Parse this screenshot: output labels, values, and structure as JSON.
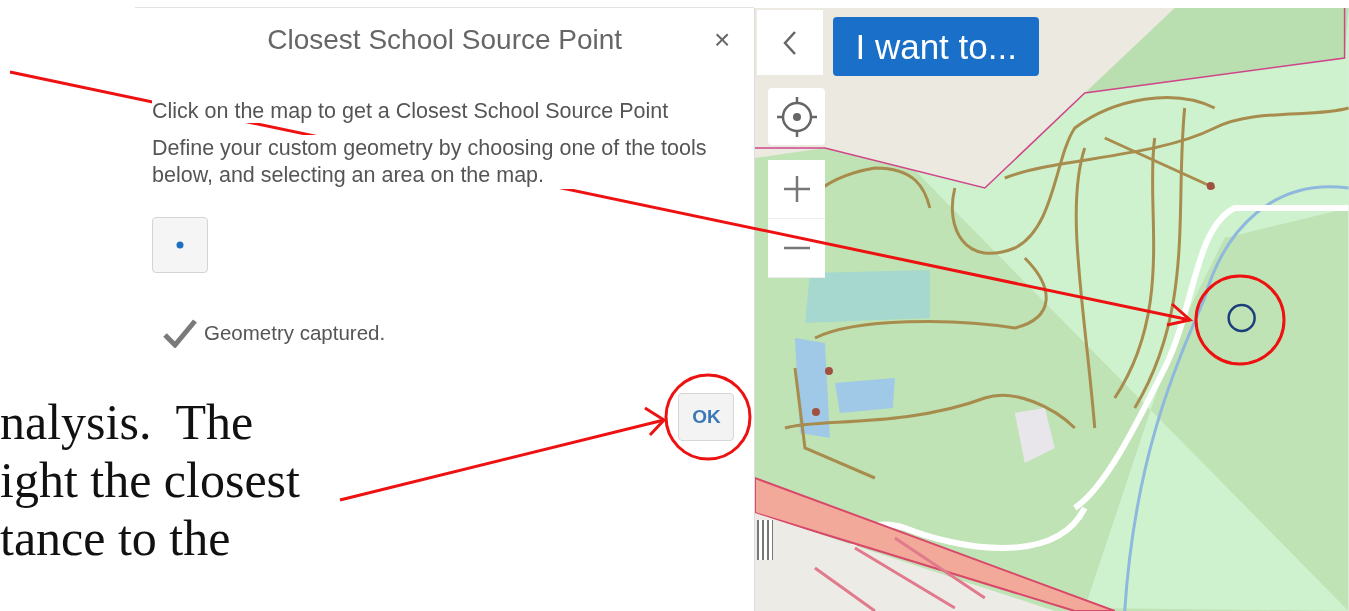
{
  "dialog": {
    "title": "Closest School Source Point",
    "close": "×",
    "instruction": "Click on the map to get a Closest School Source Point",
    "description": "Define your custom geometry by choosing one of the tools below, and selecting an area on the map.",
    "tools": [
      {
        "kind": "point"
      }
    ],
    "status": "Geometry captured.",
    "ok_button": "OK"
  },
  "map": {
    "menu_button": "I want to..."
  },
  "annotation_text": [
    "nalysis.  The",
    "ight the closest",
    "tance to the"
  ]
}
